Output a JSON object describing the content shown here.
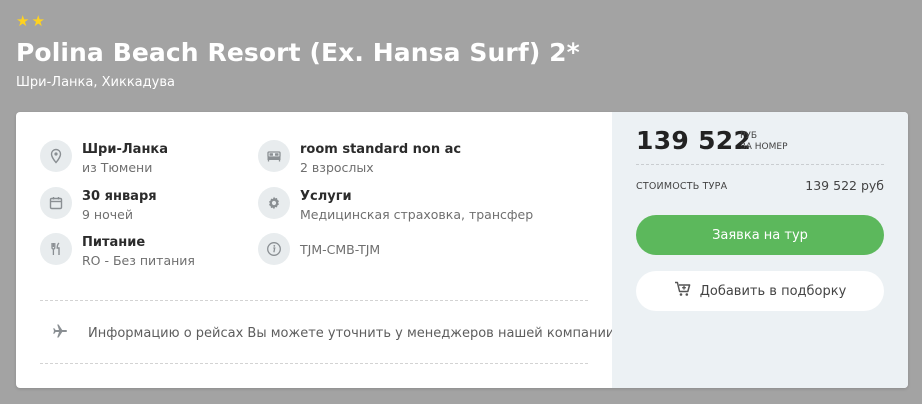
{
  "hotel": {
    "stars": 2,
    "title": "Polina Beach Resort (Ex. Hansa Surf) 2*",
    "location": "Шри-Ланка, Хиккадува"
  },
  "details": {
    "destination": {
      "icon": "location-pin-icon",
      "title": "Шри-Ланка",
      "sub": "из Тюмени"
    },
    "dates": {
      "icon": "calendar-icon",
      "title": "30 января",
      "sub": "9 ночей"
    },
    "meals": {
      "icon": "fork-knife-icon",
      "title": "Питание",
      "sub": "RO - Без питания"
    },
    "room": {
      "icon": "bed-icon",
      "title": "room standard non ac",
      "sub": "2 взрослых"
    },
    "services": {
      "icon": "gear-icon",
      "title": "Услуги",
      "sub": "Медицинская страховка, трансфер"
    },
    "route": {
      "icon": "info-icon",
      "text": "TJM-CMB-TJM"
    }
  },
  "flight": {
    "icon": "airplane-icon",
    "text": "Информацию о рейсах Вы можете уточнить у менеджеров нашей компании"
  },
  "pricing": {
    "price": "139 522",
    "currency": "РУБ",
    "per": "ЗА НОМЕР",
    "cost_label": "СТОИМОСТЬ ТУРА",
    "cost_value": "139 522 руб"
  },
  "actions": {
    "order_label": "Заявка на тур",
    "add_label": "Добавить в подборку",
    "add_icon": "cart-icon"
  },
  "colors": {
    "background": "#a3a3a3",
    "star": "#ffd21f",
    "accent_green": "#5cb85c",
    "sidebar_bg": "#ecf1f4"
  }
}
